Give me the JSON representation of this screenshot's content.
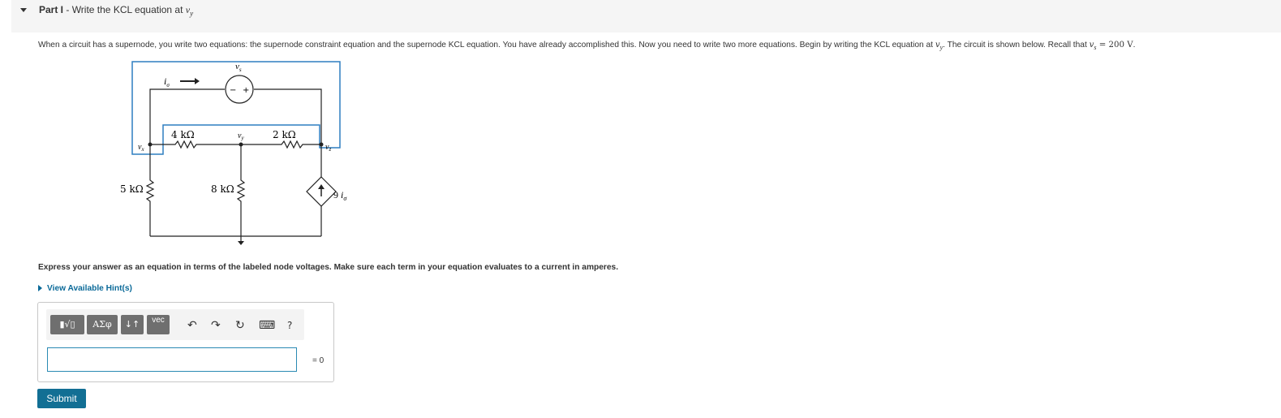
{
  "part": {
    "label": "Part I",
    "separator": " - ",
    "title_text": "Write the KCL equation at ",
    "title_var": "v",
    "title_sub": "y"
  },
  "intro": {
    "text": "When a circuit has a supernode, you write two equations: the supernode constraint equation and the supernode KCL equation. You have already accomplished this. Now you need to write two more equations. Begin by writing the KCL equation at ",
    "var": "v",
    "var_sub": "y",
    "text2": ". The circuit is shown below. Recall that ",
    "recall_var": "v",
    "recall_sub": "s",
    "recall_value": " = 200 V",
    "text3": "."
  },
  "circuit": {
    "source_label": "v",
    "source_sub": "s",
    "current_label": "i",
    "current_sub": "σ",
    "node_x": "v",
    "node_x_sub": "x",
    "node_y": "v",
    "node_y_sub": "y",
    "node_z": "v",
    "node_z_sub": "z",
    "r1": "4 kΩ",
    "r2": "2 kΩ",
    "r3": "5 kΩ",
    "r4": "8 kΩ",
    "dep_coef": "9 ",
    "dep_var": "i",
    "dep_sub": "σ",
    "minus": "−",
    "plus": "+"
  },
  "instructions": "Express your answer as an equation in terms of the labeled node voltages. Make sure each term in your equation evaluates to a current in amperes.",
  "hint_label": "View Available Hint(s)",
  "toolbar": {
    "templates_label": "▮√▯",
    "greek_label": "ΑΣφ",
    "arrows_label": "↓↑",
    "vec_label": "vec",
    "undo_glyph": "↶",
    "redo_glyph": "↷",
    "reset_glyph": "↻",
    "keyboard_glyph": "⌨",
    "help_glyph": "?"
  },
  "answer": {
    "value": "",
    "suffix": "= 0"
  },
  "submit_label": "Submit",
  "colors": {
    "accent": "#126f94",
    "supernode": "#2f7fc1",
    "link": "#0b6a99"
  }
}
